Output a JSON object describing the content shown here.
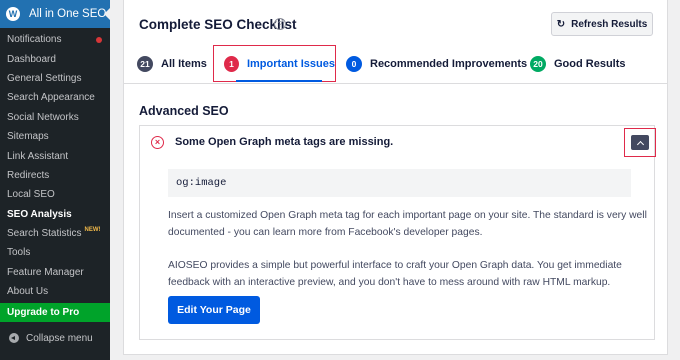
{
  "sidebar": {
    "title": "All in One SEO",
    "logo_glyph": "W",
    "items": [
      {
        "label": "Notifications",
        "badge": true
      },
      {
        "label": "Dashboard"
      },
      {
        "label": "General Settings"
      },
      {
        "label": "Search Appearance"
      },
      {
        "label": "Social Networks"
      },
      {
        "label": "Sitemaps"
      },
      {
        "label": "Link Assistant"
      },
      {
        "label": "Redirects"
      },
      {
        "label": "Local SEO"
      },
      {
        "label": "SEO Analysis",
        "active": true
      },
      {
        "label": "Search Statistics",
        "tag": "NEW!"
      },
      {
        "label": "Tools"
      },
      {
        "label": "Feature Manager"
      },
      {
        "label": "About Us"
      }
    ],
    "upgrade_label": "Upgrade to Pro",
    "collapse_label": "Collapse menu"
  },
  "checklist": {
    "title": "Complete SEO Checklist",
    "help_glyph": "?",
    "refresh_label": "Refresh Results",
    "refresh_glyph": "↻",
    "tabs": [
      {
        "count": "21",
        "label": "All Items",
        "color": "#434960"
      },
      {
        "count": "1",
        "label": "Important Issues",
        "color": "#df2a4a"
      },
      {
        "count": "0",
        "label": "Recommended Improvements",
        "color": "#005ae0"
      },
      {
        "count": "20",
        "label": "Good Results",
        "color": "#00aa63"
      }
    ]
  },
  "section": {
    "title": "Advanced SEO",
    "issue": {
      "icon": "×",
      "title": "Some Open Graph meta tags are missing.",
      "code": "og:image",
      "paragraph1": "Insert a customized Open Graph meta tag for each important page on your site. The standard is very well documented - you can learn more from Facebook's developer pages.",
      "paragraph2": "AIOSEO provides a simple but powerful interface to craft your Open Graph data. You get immediate feedback with an interactive preview, and you don't have to mess around with raw HTML markup.",
      "button_label": "Edit Your Page"
    }
  },
  "colors": {
    "accent": "#005ae0",
    "error": "#df2a4a",
    "success": "#00aa63",
    "sidebar_bg": "#1d2327",
    "brand": "#2271b1"
  }
}
